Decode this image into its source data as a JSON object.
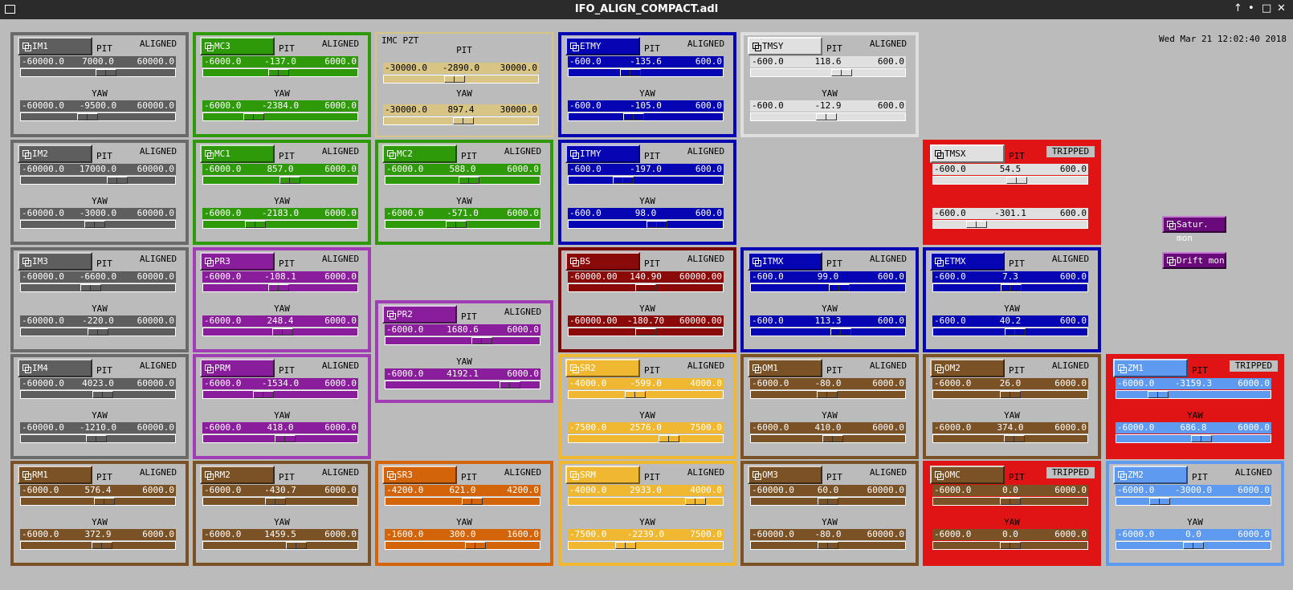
{
  "window": {
    "title": "IFO_ALIGN_COMPACT.adl",
    "controls": [
      "↑",
      "•",
      "□",
      "✕"
    ]
  },
  "timestamp": "Wed Mar 21 12:02:40 2018",
  "labels": {
    "pit": "PIT",
    "yaw": "YAW"
  },
  "colors": {
    "gray": {
      "border": "#6a6a6a",
      "fill": "#5e5e5e"
    },
    "green": {
      "border": "#2e9a0a",
      "fill": "#2e9a0a"
    },
    "blue": {
      "border": "#0505b4",
      "fill": "#0505b4"
    },
    "purple": {
      "border": "#a03cb4",
      "fill": "#8a1d9b"
    },
    "brown": {
      "border": "#7a5226",
      "fill": "#7a5226"
    },
    "orange": {
      "border": "#d4640a",
      "fill": "#d4640a"
    },
    "yellow": {
      "border": "#f0b830",
      "fill": "#f0b830"
    },
    "lightblue": {
      "border": "#5e9af0",
      "fill": "#5e9af0"
    },
    "darkred": {
      "border": "#7a0a0a",
      "fill": "#8a0a0a"
    },
    "white": {
      "border": "#dedede",
      "fill": "#e0e0e0"
    },
    "tan": {
      "border": "#d8c484",
      "fill": "#d8c484"
    },
    "tripped": "#e01414"
  },
  "panels": [
    {
      "name": "IM1",
      "theme": "gray",
      "status": "ALIGNED",
      "pit": {
        "min": "-60000.0",
        "cur": "7000.0",
        "max": "60000.0",
        "pos": 0.5583
      },
      "yaw": {
        "min": "-60000.0",
        "cur": "-9500.0",
        "max": "60000.0",
        "pos": 0.4208
      }
    },
    {
      "name": "MC3",
      "theme": "green",
      "status": "ALIGNED",
      "pit": {
        "min": "-6000.0",
        "cur": "-137.0",
        "max": "6000.0",
        "pos": 0.4886
      },
      "yaw": {
        "min": "-6000.0",
        "cur": "-2384.0",
        "max": "6000.0",
        "pos": 0.3013
      }
    },
    {
      "name": "IMC PZT",
      "theme": "tan",
      "type": "pzt",
      "status": "",
      "pit": {
        "min": "-30000.0",
        "cur": "-2890.0",
        "max": "30000.0",
        "pos": 0.4518
      },
      "yaw": {
        "min": "-30000.0",
        "cur": "897.4",
        "max": "30000.0",
        "pos": 0.515
      }
    },
    {
      "name": "ETMY",
      "theme": "blue",
      "status": "ALIGNED",
      "pit": {
        "min": "-600.0",
        "cur": "-135.6",
        "max": "600.0",
        "pos": 0.387
      },
      "yaw": {
        "min": "-600.0",
        "cur": "-105.0",
        "max": "600.0",
        "pos": 0.4125
      }
    },
    {
      "name": "TMSY",
      "theme": "white",
      "status": "ALIGNED",
      "pit": {
        "min": "-600.0",
        "cur": "118.6",
        "max": "600.0",
        "pos": 0.5988
      },
      "yaw": {
        "min": "-600.0",
        "cur": "-12.9",
        "max": "600.0",
        "pos": 0.4893
      }
    },
    {
      "name": "IM2",
      "theme": "gray",
      "status": "ALIGNED",
      "pit": {
        "min": "-60000.0",
        "cur": "17000.0",
        "max": "60000.0",
        "pos": 0.6417
      },
      "yaw": {
        "min": "-60000.0",
        "cur": "-3000.0",
        "max": "60000.0",
        "pos": 0.475
      }
    },
    {
      "name": "MC1",
      "theme": "green",
      "status": "ALIGNED",
      "pit": {
        "min": "-6000.0",
        "cur": "857.0",
        "max": "6000.0",
        "pos": 0.5714
      },
      "yaw": {
        "min": "-6000.0",
        "cur": "-2183.0",
        "max": "6000.0",
        "pos": 0.3181
      }
    },
    {
      "name": "MC2",
      "theme": "green",
      "status": "ALIGNED",
      "pit": {
        "min": "-6000.0",
        "cur": "588.0",
        "max": "6000.0",
        "pos": 0.549
      },
      "yaw": {
        "min": "-6000.0",
        "cur": "-571.0",
        "max": "6000.0",
        "pos": 0.4524
      }
    },
    {
      "name": "ITMY",
      "theme": "blue",
      "status": "ALIGNED",
      "pit": {
        "min": "-600.0",
        "cur": "-197.0",
        "max": "600.0",
        "pos": 0.3358
      },
      "yaw": {
        "min": "-600.0",
        "cur": "98.0",
        "max": "600.0",
        "pos": 0.5817
      }
    },
    {
      "name": "TMSX",
      "theme": "white",
      "status": "TRIPPED",
      "tripped": true,
      "pit": {
        "min": "-600.0",
        "cur": "54.5",
        "max": "600.0",
        "pos": 0.5454
      },
      "yaw": {
        "min": "-600.0",
        "cur": "-301.1",
        "max": "600.0",
        "pos": 0.2491
      }
    },
    {
      "name": "IM3",
      "theme": "gray",
      "status": "ALIGNED",
      "pit": {
        "min": "-60000.0",
        "cur": "-6600.0",
        "max": "60000.0",
        "pos": 0.445
      },
      "yaw": {
        "min": "-60000.0",
        "cur": "-220.0",
        "max": "60000.0",
        "pos": 0.4982
      }
    },
    {
      "name": "PR3",
      "theme": "purple",
      "status": "ALIGNED",
      "pit": {
        "min": "-6000.0",
        "cur": "-108.1",
        "max": "6000.0",
        "pos": 0.491
      },
      "yaw": {
        "min": "-6000.0",
        "cur": "248.4",
        "max": "6000.0",
        "pos": 0.5207
      }
    },
    {
      "name": "PR2",
      "theme": "purple",
      "status": "ALIGNED",
      "pit": {
        "min": "-6000.0",
        "cur": "1680.6",
        "max": "6000.0",
        "pos": 0.6401
      },
      "yaw": {
        "min": "-6000.0",
        "cur": "4192.1",
        "max": "6000.0",
        "pos": 0.8493
      }
    },
    {
      "name": "BS",
      "theme": "darkred",
      "status": "ALIGNED",
      "pit": {
        "min": "-60000.00",
        "cur": "140.90",
        "max": "60000.00",
        "pos": 0.5012
      },
      "yaw": {
        "min": "-60000.00",
        "cur": "-180.70",
        "max": "60000.00",
        "pos": 0.4985
      }
    },
    {
      "name": "ITMX",
      "theme": "blue",
      "status": "ALIGNED",
      "pit": {
        "min": "-600.0",
        "cur": "99.0",
        "max": "600.0",
        "pos": 0.5825
      },
      "yaw": {
        "min": "-600.0",
        "cur": "113.3",
        "max": "600.0",
        "pos": 0.5944
      }
    },
    {
      "name": "ETMX",
      "theme": "blue",
      "status": "ALIGNED",
      "pit": {
        "min": "-600.0",
        "cur": "7.3",
        "max": "600.0",
        "pos": 0.5061
      },
      "yaw": {
        "min": "-600.0",
        "cur": "40.2",
        "max": "600.0",
        "pos": 0.5335
      }
    },
    {
      "name": "IM4",
      "theme": "gray",
      "status": "ALIGNED",
      "pit": {
        "min": "-60000.0",
        "cur": "4023.0",
        "max": "60000.0",
        "pos": 0.5335
      },
      "yaw": {
        "min": "-60000.0",
        "cur": "-1210.0",
        "max": "60000.0",
        "pos": 0.4899
      }
    },
    {
      "name": "PRM",
      "theme": "purple",
      "status": "ALIGNED",
      "pit": {
        "min": "-6000.0",
        "cur": "-1534.0",
        "max": "6000.0",
        "pos": 0.3722
      },
      "yaw": {
        "min": "-6000.0",
        "cur": "418.0",
        "max": "6000.0",
        "pos": 0.5348
      }
    },
    {
      "name": "SR2",
      "theme": "yellow",
      "status": "ALIGNED",
      "pit": {
        "min": "-4000.0",
        "cur": "-599.0",
        "max": "4000.0",
        "pos": 0.4251
      },
      "yaw": {
        "min": "-7500.0",
        "cur": "2576.0",
        "max": "7500.0",
        "pos": 0.6717
      }
    },
    {
      "name": "OM1",
      "theme": "brown",
      "status": "ALIGNED",
      "pit": {
        "min": "-6000.0",
        "cur": "-80.0",
        "max": "6000.0",
        "pos": 0.4933
      },
      "yaw": {
        "min": "-6000.0",
        "cur": "410.0",
        "max": "6000.0",
        "pos": 0.5342
      }
    },
    {
      "name": "OM2",
      "theme": "brown",
      "status": "ALIGNED",
      "pit": {
        "min": "-6000.0",
        "cur": "26.0",
        "max": "6000.0",
        "pos": 0.5022
      },
      "yaw": {
        "min": "-6000.0",
        "cur": "374.0",
        "max": "6000.0",
        "pos": 0.5312
      }
    },
    {
      "name": "ZM1",
      "theme": "lightblue",
      "status": "TRIPPED",
      "tripped": true,
      "pit": {
        "min": "-6000.0",
        "cur": "-3159.3",
        "max": "6000.0",
        "pos": 0.2367
      },
      "yaw": {
        "min": "-6000.0",
        "cur": "686.8",
        "max": "6000.0",
        "pos": 0.5572
      }
    },
    {
      "name": "RM1",
      "theme": "brown",
      "status": "ALIGNED",
      "pit": {
        "min": "-6000.0",
        "cur": "576.4",
        "max": "6000.0",
        "pos": 0.548
      },
      "yaw": {
        "min": "-6000.0",
        "cur": "372.9",
        "max": "6000.0",
        "pos": 0.5311
      }
    },
    {
      "name": "RM2",
      "theme": "brown",
      "status": "ALIGNED",
      "pit": {
        "min": "-6000.0",
        "cur": "-430.7",
        "max": "6000.0",
        "pos": 0.4641
      },
      "yaw": {
        "min": "-6000.0",
        "cur": "1459.5",
        "max": "6000.0",
        "pos": 0.6216
      }
    },
    {
      "name": "SR3",
      "theme": "orange",
      "status": "ALIGNED",
      "pit": {
        "min": "-4200.0",
        "cur": "621.0",
        "max": "4200.0",
        "pos": 0.5739
      },
      "yaw": {
        "min": "-1600.0",
        "cur": "300.0",
        "max": "1600.0",
        "pos": 0.5938
      }
    },
    {
      "name": "SRM",
      "theme": "yellow",
      "status": "ALIGNED",
      "pit": {
        "min": "-4000.0",
        "cur": "2933.0",
        "max": "4000.0",
        "pos": 0.8666
      },
      "yaw": {
        "min": "-7500.0",
        "cur": "-2239.0",
        "max": "7500.0",
        "pos": 0.3507
      }
    },
    {
      "name": "OM3",
      "theme": "brown",
      "status": "ALIGNED",
      "pit": {
        "min": "-60000.0",
        "cur": "60.0",
        "max": "60000.0",
        "pos": 0.5005
      },
      "yaw": {
        "min": "-60000.0",
        "cur": "-80.0",
        "max": "60000.0",
        "pos": 0.4993
      }
    },
    {
      "name": "OMC",
      "theme": "brown",
      "status": "TRIPPED",
      "tripped": true,
      "pit": {
        "min": "-6000.0",
        "cur": "0.0",
        "max": "6000.0",
        "pos": 0.5
      },
      "yaw": {
        "min": "-6000.0",
        "cur": "0.0",
        "max": "6000.0",
        "pos": 0.5
      }
    },
    {
      "name": "ZM2",
      "theme": "lightblue",
      "status": "ALIGNED",
      "pit": {
        "min": "-6000.0",
        "cur": "-3000.0",
        "max": "6000.0",
        "pos": 0.25
      },
      "yaw": {
        "min": "-6000.0",
        "cur": "0.0",
        "max": "6000.0",
        "pos": 0.5
      }
    }
  ],
  "monitors": [
    {
      "label": "Satur. mon"
    },
    {
      "label": "Drift mon"
    }
  ]
}
